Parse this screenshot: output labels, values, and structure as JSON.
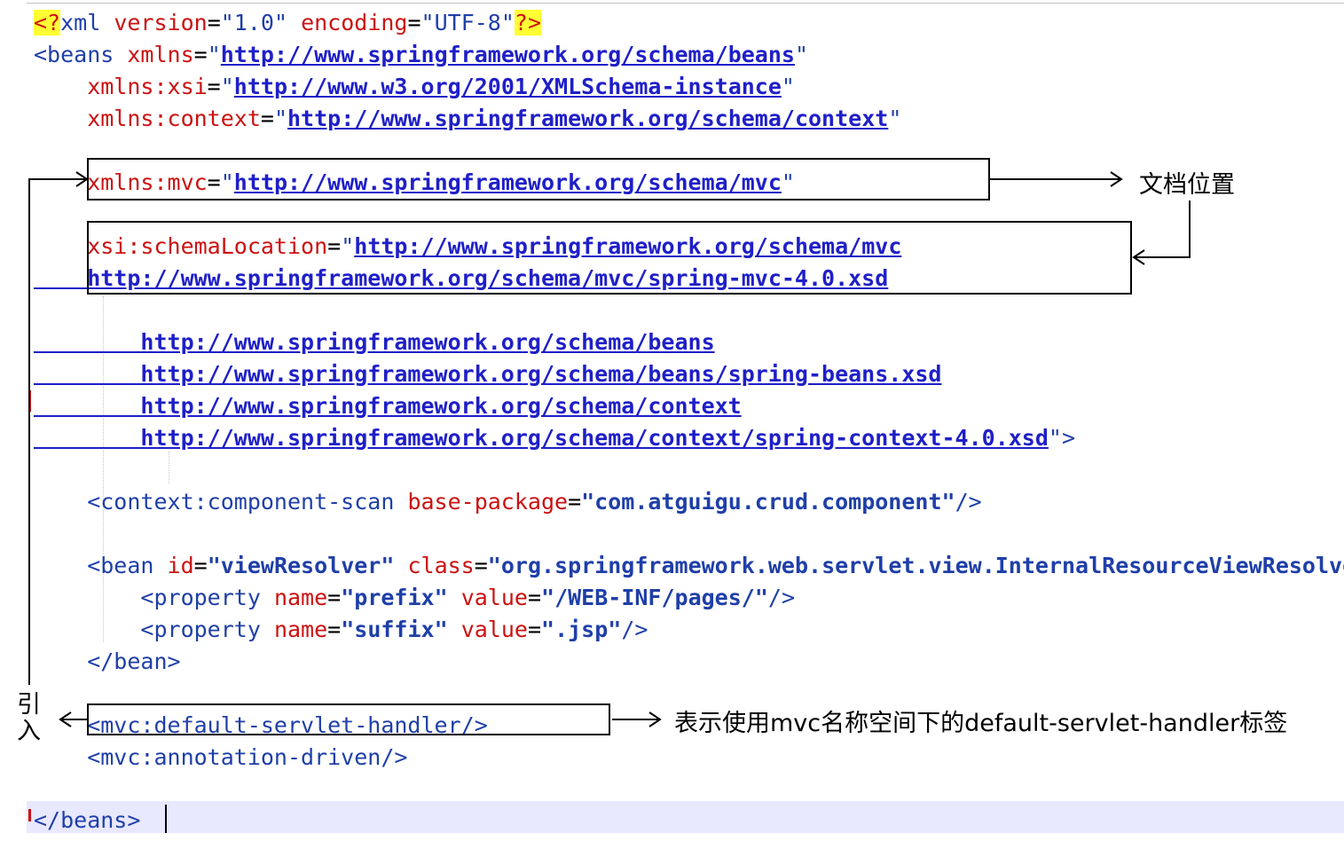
{
  "lines": [
    {
      "id": "l1",
      "parts": [
        [
          "pi",
          "<?"
        ],
        [
          "kw",
          "xml "
        ],
        [
          "attr",
          "version"
        ],
        [
          "eq",
          "="
        ],
        [
          "q",
          "\"1.0\" "
        ],
        [
          "attr",
          "encoding"
        ],
        [
          "eq",
          "="
        ],
        [
          "q",
          "\"UTF-8\""
        ],
        [
          "pi",
          "?>"
        ]
      ]
    },
    {
      "id": "l2",
      "parts": [
        [
          "tag",
          "<beans "
        ],
        [
          "attr",
          "xmlns"
        ],
        [
          "eq",
          "="
        ],
        [
          "q",
          "\""
        ],
        [
          "url",
          "http://www.springframework.org/schema/beans"
        ],
        [
          "q",
          "\""
        ]
      ]
    },
    {
      "id": "l3",
      "parts": [
        [
          "attr",
          "    xmlns:xsi"
        ],
        [
          "eq",
          "="
        ],
        [
          "q",
          "\""
        ],
        [
          "url",
          "http://www.w3.org/2001/XMLSchema-instance"
        ],
        [
          "q",
          "\""
        ]
      ]
    },
    {
      "id": "l4",
      "parts": [
        [
          "attr",
          "    xmlns:context"
        ],
        [
          "eq",
          "="
        ],
        [
          "q",
          "\""
        ],
        [
          "url",
          "http://www.springframework.org/schema/context"
        ],
        [
          "q",
          "\""
        ]
      ]
    },
    {
      "id": "l5",
      "parts": []
    },
    {
      "id": "l6",
      "parts": [
        [
          "attr",
          "    xmlns:mvc"
        ],
        [
          "eq",
          "="
        ],
        [
          "q",
          "\""
        ],
        [
          "url",
          "http://www.springframework.org/schema/mvc"
        ],
        [
          "q",
          "\""
        ]
      ]
    },
    {
      "id": "l7",
      "parts": []
    },
    {
      "id": "l8",
      "parts": [
        [
          "attr",
          "    xsi:schemaLocation"
        ],
        [
          "eq",
          "="
        ],
        [
          "q",
          "\""
        ],
        [
          "url",
          "http://www.springframework.org/schema/mvc"
        ]
      ]
    },
    {
      "id": "l9",
      "parts": [
        [
          "url",
          "    http://www.springframework.org/schema/mvc/spring-mvc-4.0.xsd"
        ]
      ]
    },
    {
      "id": "l10",
      "parts": []
    },
    {
      "id": "l11",
      "parts": [
        [
          "url",
          "        http://www.springframework.org/schema/beans"
        ]
      ]
    },
    {
      "id": "l12",
      "parts": [
        [
          "url",
          "        http://www.springframework.org/schema/beans/spring-beans.xsd"
        ]
      ]
    },
    {
      "id": "l13",
      "parts": [
        [
          "url",
          "        http://www.springframework.org/schema/context"
        ]
      ]
    },
    {
      "id": "l14",
      "parts": [
        [
          "url",
          "        http://www.springframework.org/schema/context/spring-context-4.0.xsd"
        ],
        [
          "q",
          "\">"
        ]
      ]
    },
    {
      "id": "l15",
      "parts": []
    },
    {
      "id": "l16",
      "parts": [
        [
          "tag",
          "    <context:component-scan "
        ],
        [
          "attr",
          "base-package"
        ],
        [
          "eq",
          "="
        ],
        [
          "val",
          "\"com.atguigu.crud.component\""
        ],
        [
          "tag",
          "/>"
        ]
      ]
    },
    {
      "id": "l17",
      "parts": []
    },
    {
      "id": "l18",
      "parts": [
        [
          "tag",
          "    <bean "
        ],
        [
          "attr",
          "id"
        ],
        [
          "eq",
          "="
        ],
        [
          "val",
          "\"viewResolver\" "
        ],
        [
          "attr",
          "class"
        ],
        [
          "eq",
          "="
        ],
        [
          "val",
          "\"org.springframework.web.servlet.view.InternalResourceViewResolver\""
        ],
        [
          "tag",
          ">"
        ]
      ]
    },
    {
      "id": "l19",
      "parts": [
        [
          "tag",
          "        <property "
        ],
        [
          "attr",
          "name"
        ],
        [
          "eq",
          "="
        ],
        [
          "val",
          "\"prefix\" "
        ],
        [
          "attr",
          "value"
        ],
        [
          "eq",
          "="
        ],
        [
          "val",
          "\"/WEB-INF/pages/\""
        ],
        [
          "tag",
          "/>"
        ]
      ]
    },
    {
      "id": "l20",
      "parts": [
        [
          "tag",
          "        <property "
        ],
        [
          "attr",
          "name"
        ],
        [
          "eq",
          "="
        ],
        [
          "val",
          "\"suffix\" "
        ],
        [
          "attr",
          "value"
        ],
        [
          "eq",
          "="
        ],
        [
          "val",
          "\".jsp\""
        ],
        [
          "tag",
          "/>"
        ]
      ]
    },
    {
      "id": "l21",
      "parts": [
        [
          "tag",
          "    </bean>"
        ]
      ]
    },
    {
      "id": "l22",
      "parts": []
    },
    {
      "id": "l23",
      "parts": [
        [
          "tag",
          "    <mvc:default-servlet-handler/>"
        ]
      ]
    },
    {
      "id": "l24",
      "parts": [
        [
          "tag",
          "    <mvc:annotation-driven/>"
        ]
      ]
    },
    {
      "id": "l25",
      "parts": []
    },
    {
      "id": "l26",
      "parts": [
        [
          "tag",
          "</beans>"
        ]
      ]
    }
  ],
  "annotations": {
    "doc_location": "文档位置",
    "import": "引入",
    "servlet_handler_note": "表示使用mvc名称空间下的default-servlet-handler标签"
  },
  "colors": {
    "tag": "#1f3fa8",
    "attr": "#cc1111",
    "url": "#1f1fc8",
    "pi_highlight": "#ffff33",
    "current_line": "#e8e8ff"
  }
}
